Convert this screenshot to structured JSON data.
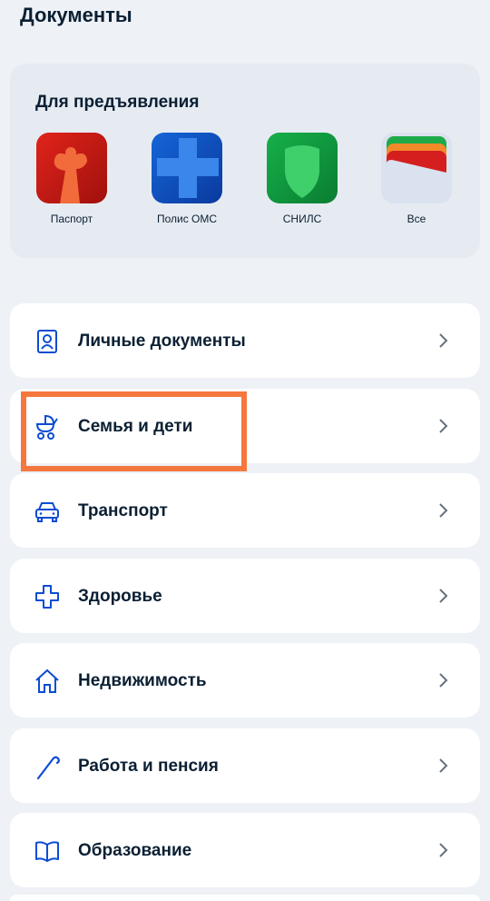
{
  "header": {
    "title": "Документы"
  },
  "presentation": {
    "title": "Для предъявления",
    "docs": [
      {
        "label": "Паспорт",
        "icon": "passport-icon"
      },
      {
        "label": "Полис ОМС",
        "icon": "oms-policy-icon"
      },
      {
        "label": "СНИЛС",
        "icon": "snils-icon"
      },
      {
        "label": "Все",
        "icon": "wallet-icon"
      }
    ]
  },
  "categories": [
    {
      "label": "Личные документы",
      "icon": "id-card-icon"
    },
    {
      "label": "Семья и дети",
      "icon": "baby-stroller-icon"
    },
    {
      "label": "Транспорт",
      "icon": "car-icon"
    },
    {
      "label": "Здоровье",
      "icon": "medical-cross-icon"
    },
    {
      "label": "Недвижимость",
      "icon": "house-icon"
    },
    {
      "label": "Работа и пенсия",
      "icon": "cane-icon"
    },
    {
      "label": "Образование",
      "icon": "book-icon"
    }
  ],
  "colors": {
    "accent_blue": "#0d4cd3",
    "highlight": "#f4773e",
    "background": "#eef1f6"
  }
}
